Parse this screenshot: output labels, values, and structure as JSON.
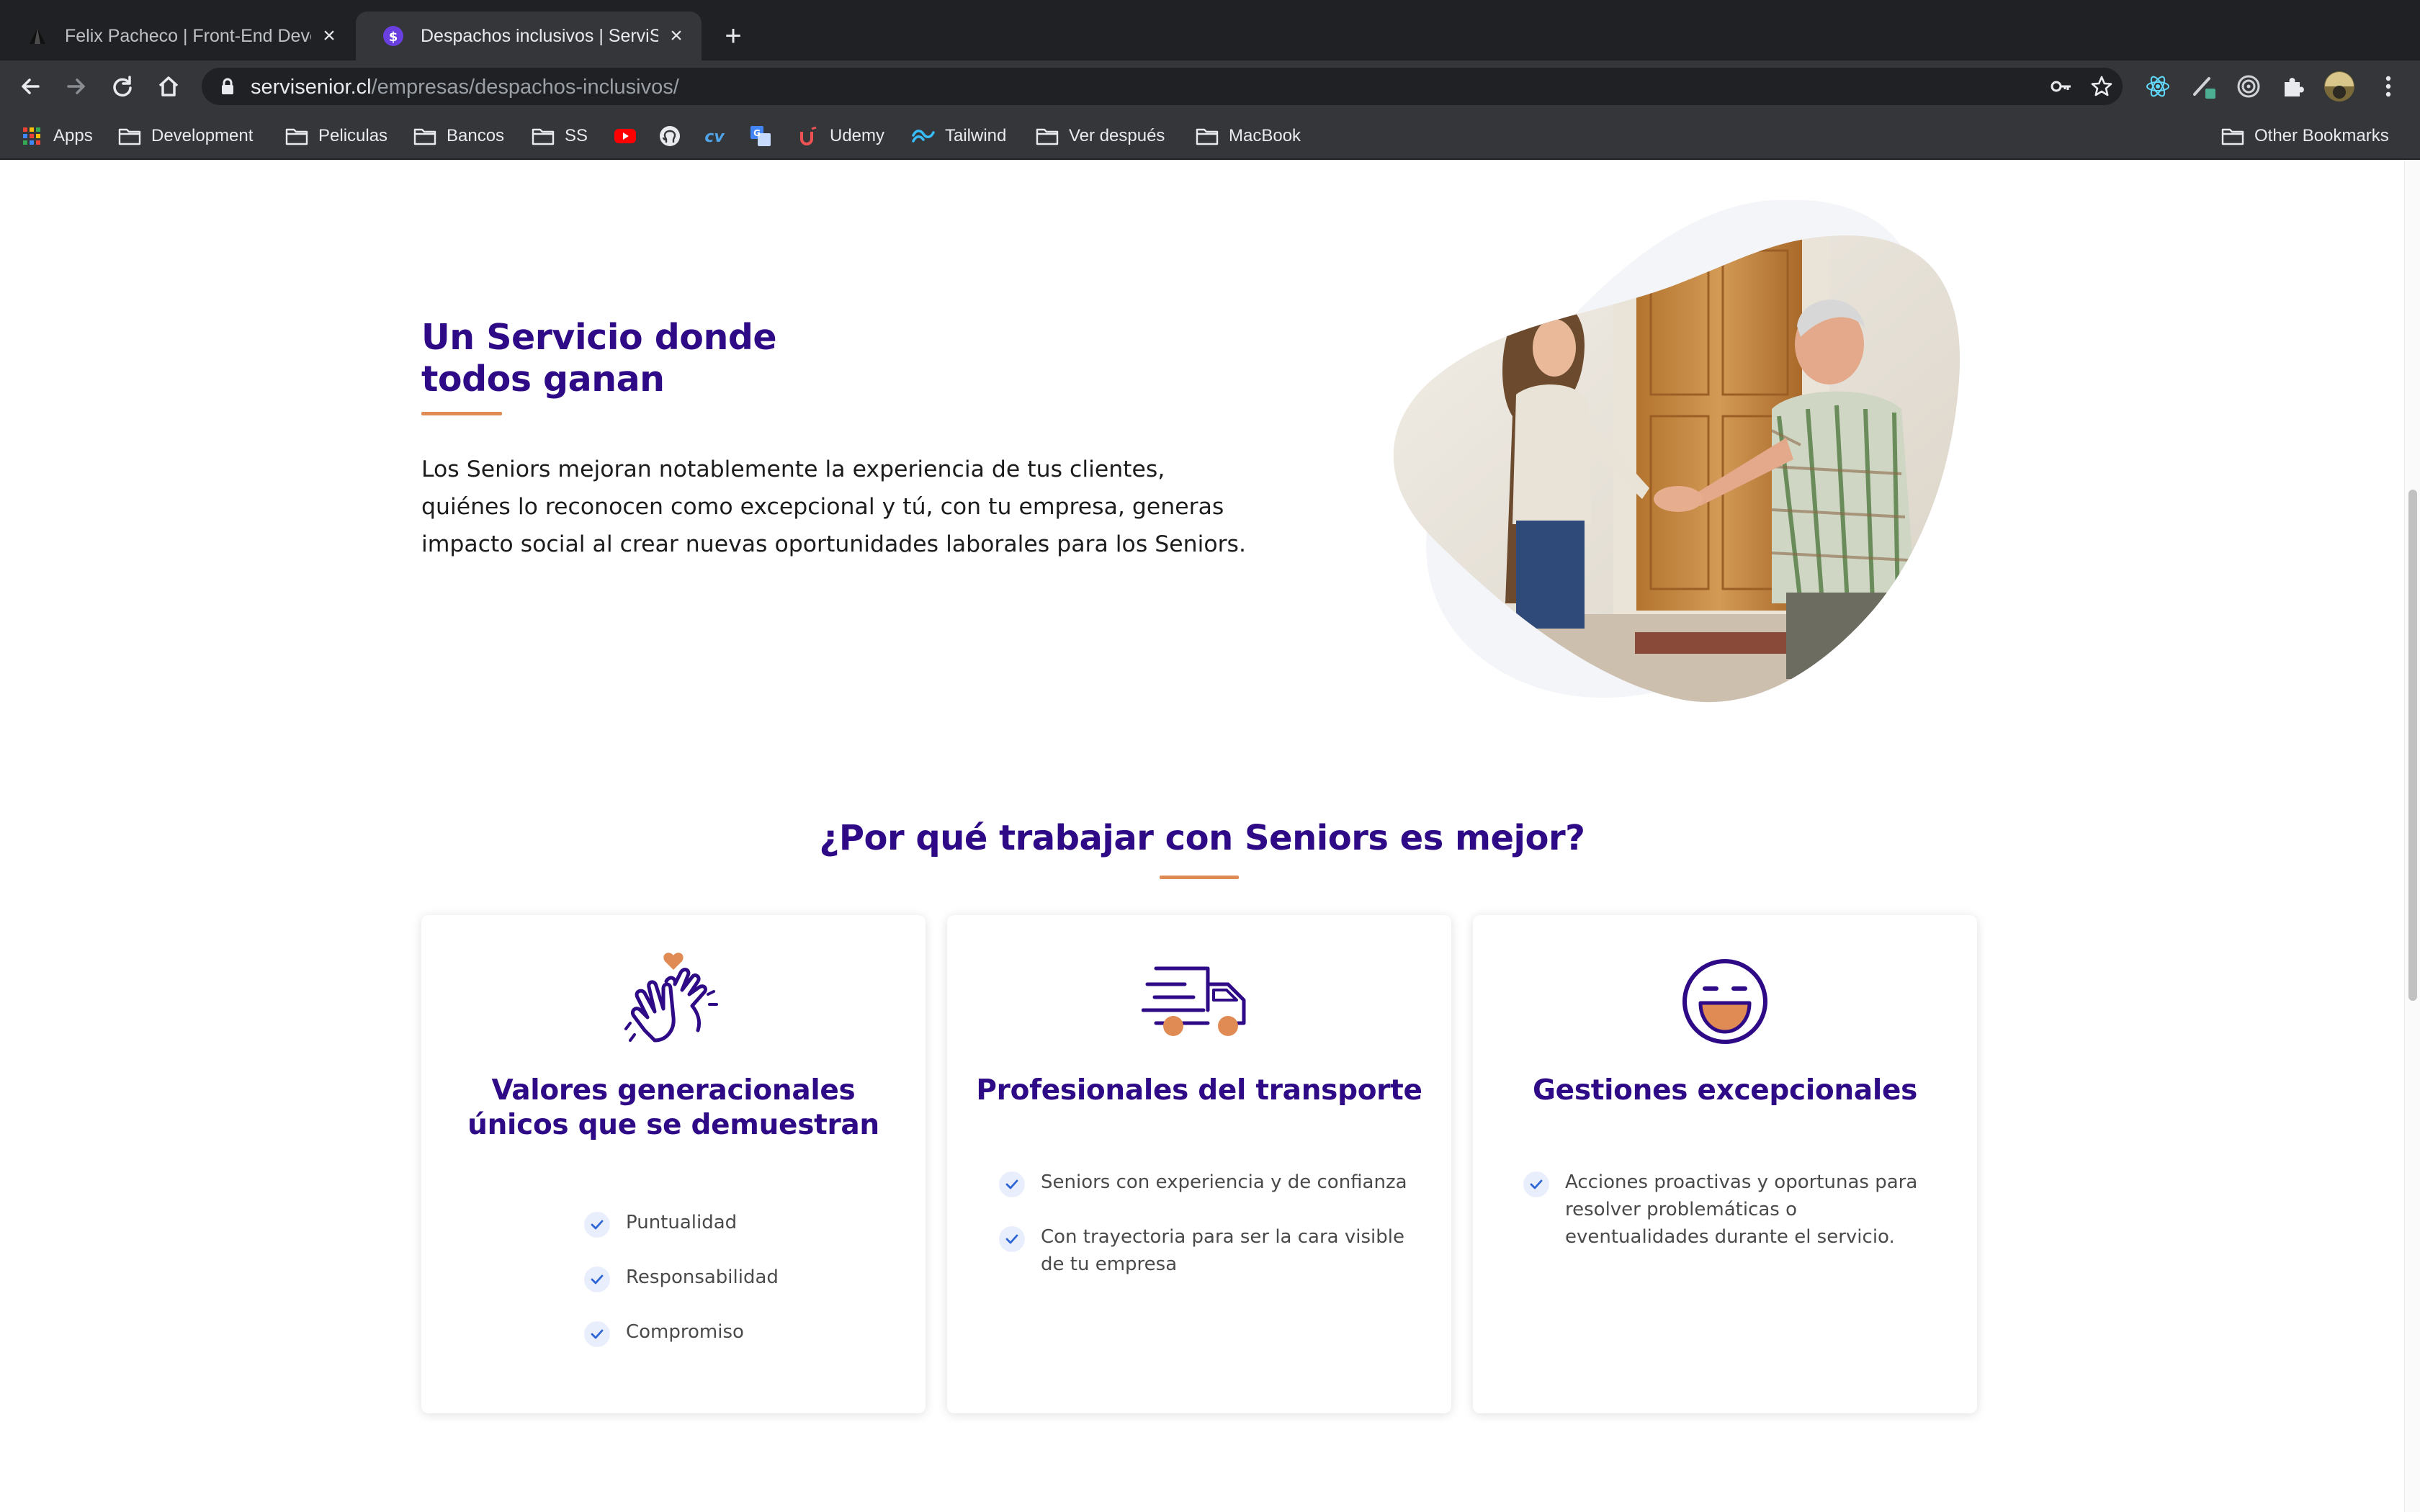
{
  "browser": {
    "tabs": [
      {
        "title": "Felix Pacheco | Front-End Developer",
        "active": false,
        "favicon": "black-triangle-icon"
      },
      {
        "title": "Despachos inclusivos | ServiSenior",
        "active": true,
        "favicon": "servisenior-s-icon"
      }
    ],
    "url": {
      "host": "servisenior.cl",
      "path": "/empresas/despachos-inclusivos/"
    },
    "bookmarks": [
      {
        "label": "Apps",
        "icon": "apps-grid-icon"
      },
      {
        "label": "Development",
        "icon": "folder-icon"
      },
      {
        "label": "Peliculas",
        "icon": "folder-icon"
      },
      {
        "label": "Bancos",
        "icon": "folder-icon"
      },
      {
        "label": "SS",
        "icon": "folder-icon"
      },
      {
        "label": "",
        "icon": "youtube-icon"
      },
      {
        "label": "",
        "icon": "github-icon"
      },
      {
        "label": "",
        "icon": "cv-icon"
      },
      {
        "label": "",
        "icon": "translate-icon"
      },
      {
        "label": "Udemy",
        "icon": "udemy-icon"
      },
      {
        "label": "Tailwind",
        "icon": "tailwind-icon"
      },
      {
        "label": "Ver después",
        "icon": "folder-icon"
      },
      {
        "label": "MacBook",
        "icon": "folder-icon"
      }
    ],
    "other_bookmarks": "Other Bookmarks"
  },
  "hero": {
    "title_line1": "Un Servicio donde",
    "title_line2": "todos ganan",
    "text_line1": "Los Seniors mejoran notablemente la experiencia de tus clientes,",
    "text_line2": "quiénes lo reconocen como excepcional y tú, con tu empresa, generas",
    "text_line3": "impacto social al crear nuevas oportunidades laborales para los Seniors."
  },
  "why": {
    "title": "¿Por qué trabajar con Seniors es mejor?"
  },
  "cards": [
    {
      "icon": "clapping-hands-heart-icon",
      "title_line1": "Valores generacionales",
      "title_line2": "únicos que se demuestran",
      "items": [
        "Puntualidad",
        "Responsabilidad",
        "Compromiso"
      ]
    },
    {
      "icon": "delivery-truck-icon",
      "title_line1": "Profesionales del transporte",
      "items": [
        "Seniors con experiencia y de confianza",
        "Con trayectoria para ser la cara visible de tu empresa"
      ]
    },
    {
      "icon": "happy-face-icon",
      "title_line1": "Gestiones excepcionales",
      "items": [
        "Acciones proactivas y oportunas para resolver problemáticas o eventualidades durante el servicio."
      ]
    }
  ],
  "colors": {
    "brand_purple": "#2e0a86",
    "accent_orange": "#e08a54",
    "chrome_dark": "#202124",
    "chrome_toolbar": "#35363a"
  }
}
